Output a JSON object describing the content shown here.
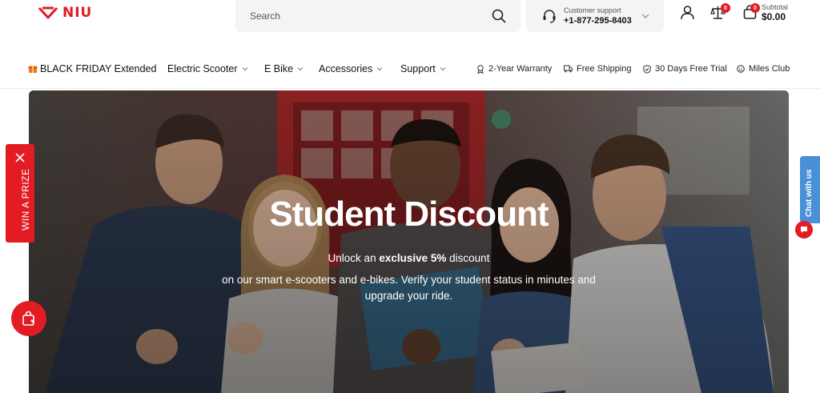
{
  "header": {
    "logo_text": "NIU",
    "search_placeholder": "Search",
    "support": {
      "label": "Customer support",
      "phone": "+1-877-295-8403"
    },
    "compare_count": "0",
    "cart_count": "0",
    "subtotal_label": "Subtotal",
    "subtotal_value": "$0.00"
  },
  "nav": {
    "items": [
      {
        "label": "BLACK FRIDAY Extended",
        "icon": "gift-icon"
      },
      {
        "label": "Electric Scooter",
        "dropdown": true
      },
      {
        "label": "E Bike",
        "dropdown": true
      },
      {
        "label": "Accessories",
        "dropdown": true
      },
      {
        "label": "Support",
        "dropdown": true
      }
    ],
    "perks": [
      {
        "label": "2-Year Warranty",
        "icon": "medal-icon"
      },
      {
        "label": "Free Shipping",
        "icon": "truck-icon"
      },
      {
        "label": "30 Days Free Trial",
        "icon": "shield-icon"
      },
      {
        "label": "Miles Club",
        "icon": "smile-icon"
      }
    ]
  },
  "hero": {
    "title": "Student Discount",
    "line1_prefix": "Unlock an ",
    "line1_bold": "exclusive 5%",
    "line1_suffix": " discount",
    "line2": "on our smart e-scooters and e-bikes. Verify your student status in minutes and",
    "line3": "upgrade your ride."
  },
  "widgets": {
    "prize_label": "WIN A PRIZE",
    "chat_label": "Chat with us"
  },
  "colors": {
    "brand": "#e31b23",
    "chat": "#4a90d9"
  }
}
